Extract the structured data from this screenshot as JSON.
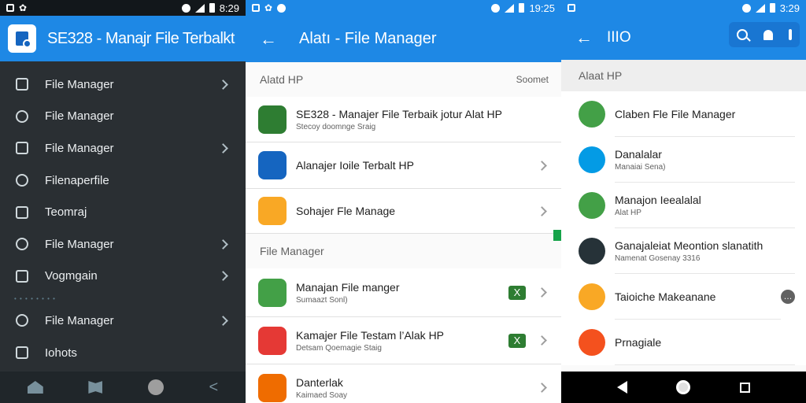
{
  "status_bars": {
    "s1_time": "8:29",
    "s2_time": "19:25",
    "s3_time": "3:29"
  },
  "drawer": {
    "title": "SE328 - Manajr File Terbalkt",
    "section_caption": "• • • • • • • •",
    "items": [
      {
        "label": "File Manager",
        "icon": "edit-icon",
        "chevron": true
      },
      {
        "label": "File Manager",
        "icon": "compass-icon",
        "chevron": false
      },
      {
        "label": "File Manager",
        "icon": "image-icon",
        "chevron": true
      },
      {
        "label": "Filenaperfile",
        "icon": "book-icon",
        "chevron": false
      },
      {
        "label": "Teomraj",
        "icon": "refresh-icon",
        "chevron": false
      },
      {
        "label": "File Manager",
        "icon": "file-icon",
        "chevron": true
      },
      {
        "label": "Vogmgain",
        "icon": "folder-icon",
        "chevron": true
      },
      {
        "label": "File Manager",
        "icon": "briefcase-icon",
        "chevron": true
      },
      {
        "label": "Iohots",
        "icon": "settings-icon",
        "chevron": false
      }
    ]
  },
  "screen2": {
    "title": "Alatı - File Manager",
    "section1": {
      "label": "Alatd HP",
      "link": "Soomet"
    },
    "section2": {
      "label": "File Manager"
    },
    "rows": [
      {
        "title": "SE328 - Manajer File Terbaik jotur Alat HP",
        "subtitle": "Stecoy doomnge Sraig",
        "icon": "game-app-icon",
        "color": "#2e7d32",
        "badge": false,
        "chevron": false
      },
      {
        "title": "Alanajer Ioile Terbalt HP",
        "subtitle": "",
        "icon": "photo-app-icon",
        "color": "#1565c0",
        "badge": false,
        "chevron": true
      },
      {
        "title": "Sohajer Fle Manage",
        "subtitle": "",
        "icon": "folder-app-icon",
        "color": "#f9a825",
        "badge": false,
        "chevron": true
      },
      {
        "title": "Manajan File manger",
        "subtitle": "Sumaazt Sonl)",
        "icon": "manager-app-icon",
        "color": "#43a047",
        "badge": true,
        "badge_label": "X",
        "chevron": true
      },
      {
        "title": "Kamajer File Testam l’Alak HP",
        "subtitle": "Detsam Qoemagie Staig",
        "icon": "gear-app-icon",
        "color": "#e53935",
        "badge": true,
        "badge_label": "X",
        "chevron": true
      },
      {
        "title": "Danterlak",
        "subtitle": "Kaimaed Soay",
        "icon": "dl-app-icon",
        "color": "#ef6c00",
        "badge": false,
        "chevron": true
      }
    ]
  },
  "screen3": {
    "title": "IIIO",
    "section_label": "Alaat HP",
    "rows": [
      {
        "title": "Claben Fle File Manager",
        "subtitle": "",
        "icon": "clipboard-app-icon",
        "color": "#43a047",
        "action": false
      },
      {
        "title": "Danalalar",
        "subtitle": "Manaiai Sena)",
        "icon": "tool-app-icon",
        "color": "#039be5",
        "action": false
      },
      {
        "title": "Manajon Ieealalal",
        "subtitle": "Alat HP",
        "icon": "chat-app-icon",
        "color": "#43a047",
        "action": false
      },
      {
        "title": "Ganajaleiat Meontion slanatith",
        "subtitle": "Namenat Gosenay 3316",
        "icon": "phone-app-icon",
        "color": "#263238",
        "action": false
      },
      {
        "title": "Taioiche Makeanane",
        "subtitle": "",
        "icon": "star-app-icon",
        "color": "#f9a825",
        "action": true,
        "action_label": "…"
      },
      {
        "title": "Prnagiale",
        "subtitle": "",
        "icon": "pager-app-icon",
        "color": "#f4511e",
        "action": false
      }
    ]
  }
}
